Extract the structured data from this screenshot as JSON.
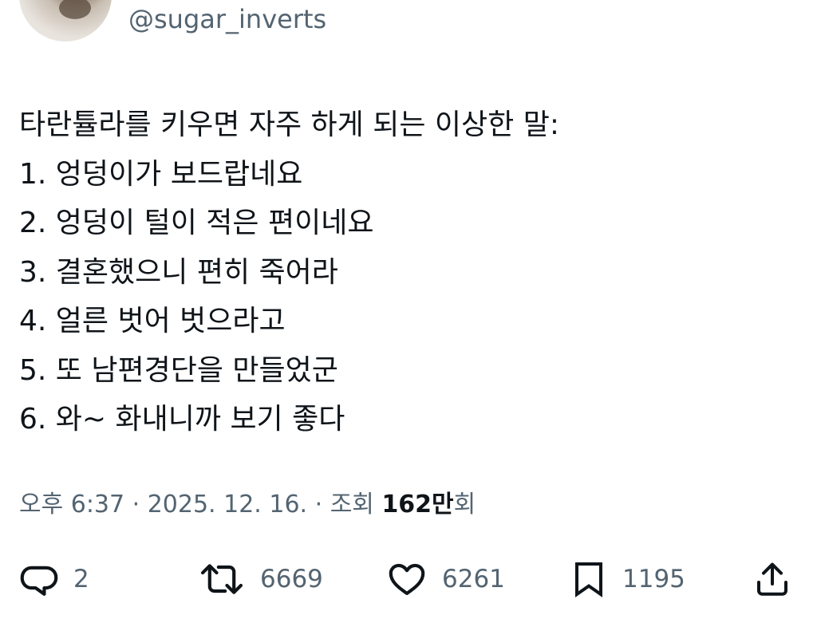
{
  "author": {
    "handle": "@sugar_inverts",
    "avatar_icon": "profile-avatar"
  },
  "tweet": {
    "lines": [
      "타란튤라를 키우면 자주 하게 되는 이상한 말:",
      "1. 엉덩이가 보드랍네요",
      "2. 엉덩이 털이 적은 편이네요",
      "3. 결혼했으니 편히 죽어라",
      "4. 얼른 벗어 벗으라고",
      "5. 또 남편경단을 만들었군",
      "6. 와~ 화내니까 보기 좋다"
    ]
  },
  "meta": {
    "timestamp": "오후 6:37 · 2025. 12. 16. · 조회 ",
    "views_count": "162만",
    "views_suffix": "회"
  },
  "actions": {
    "reply": {
      "icon": "reply-bubble-icon",
      "count": "2"
    },
    "retweet": {
      "icon": "retweet-icon",
      "count": "6669"
    },
    "like": {
      "icon": "heart-icon",
      "count": "6261"
    },
    "bookmark": {
      "icon": "bookmark-icon",
      "count": "1195"
    },
    "share": {
      "icon": "share-icon"
    }
  },
  "colors": {
    "text_primary": "#0f1419",
    "text_secondary": "#536471",
    "background": "#ffffff"
  }
}
